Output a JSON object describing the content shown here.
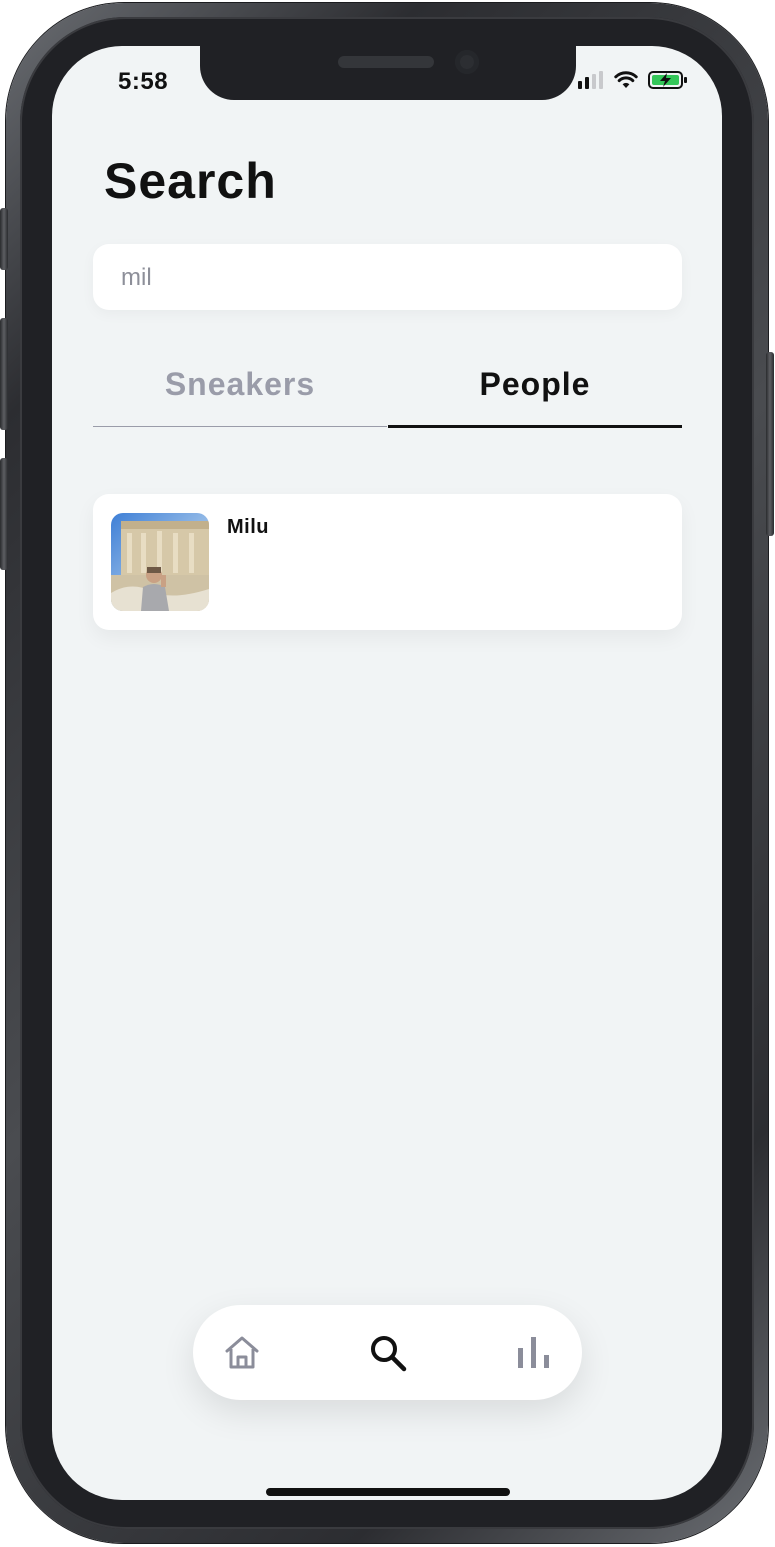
{
  "status_bar": {
    "time": "5:58"
  },
  "header": {
    "title": "Search"
  },
  "search": {
    "value": "mil",
    "placeholder": ""
  },
  "tabs": [
    {
      "label": "Sneakers",
      "active": false
    },
    {
      "label": "People",
      "active": true
    }
  ],
  "results": [
    {
      "name": "Milu",
      "avatar": "user-photo"
    }
  ],
  "bottom_nav": [
    {
      "icon": "home-icon",
      "active": false
    },
    {
      "icon": "search-icon",
      "active": true
    },
    {
      "icon": "bar-chart-icon",
      "active": false
    }
  ],
  "colors": {
    "background": "#f1f4f5",
    "active_text": "#111111",
    "inactive_text": "#9a9ca9",
    "battery_green": "#34c759"
  }
}
